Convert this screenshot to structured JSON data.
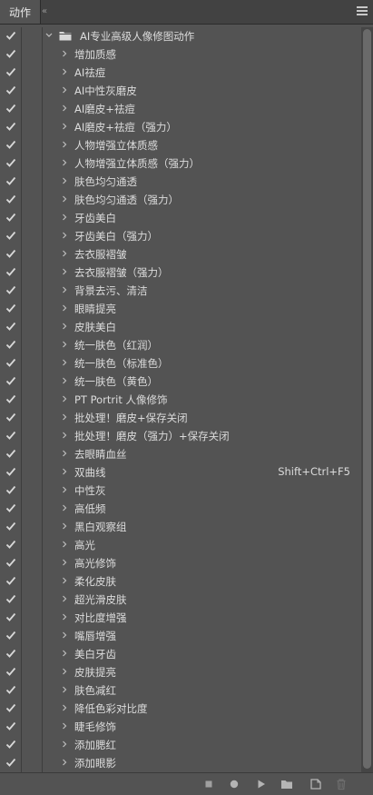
{
  "panel": {
    "tab_label": "动作",
    "tab_close": "«"
  },
  "set": {
    "name": "AI专业高级人像修图动作"
  },
  "actions": [
    {
      "label": "增加质感",
      "dialog": false
    },
    {
      "label": "AI祛痘",
      "dialog": false
    },
    {
      "label": "AI中性灰磨皮",
      "dialog": false
    },
    {
      "label": "AI磨皮+祛痘",
      "dialog": false
    },
    {
      "label": "AI磨皮+祛痘（强力）",
      "dialog": false
    },
    {
      "label": "人物增强立体质感",
      "dialog": false
    },
    {
      "label": "人物增强立体质感（强力）",
      "dialog": false
    },
    {
      "label": "肤色均匀通透",
      "dialog": false
    },
    {
      "label": "肤色均匀通透（强力）",
      "dialog": false
    },
    {
      "label": "牙齿美白",
      "dialog": false
    },
    {
      "label": "牙齿美白（强力）",
      "dialog": false
    },
    {
      "label": "去衣服褶皱",
      "dialog": false
    },
    {
      "label": "去衣服褶皱（强力）",
      "dialog": false
    },
    {
      "label": "背景去污、清洁",
      "dialog": false
    },
    {
      "label": "眼睛提亮",
      "dialog": false
    },
    {
      "label": "皮肤美白",
      "dialog": false
    },
    {
      "label": "统一肤色（红润）",
      "dialog": false
    },
    {
      "label": "统一肤色（标准色）",
      "dialog": false
    },
    {
      "label": "统一肤色（黄色）",
      "dialog": false
    },
    {
      "label": "PT Portrit 人像修饰",
      "dialog": false
    },
    {
      "label": "批处理！磨皮+保存关闭",
      "dialog": false
    },
    {
      "label": "批处理！磨皮（强力）+保存关闭",
      "dialog": false
    },
    {
      "label": "去眼睛血丝",
      "dialog": false
    },
    {
      "label": "双曲线",
      "dialog": false,
      "shortcut": "Shift+Ctrl+F5"
    },
    {
      "label": "中性灰",
      "dialog": false
    },
    {
      "label": "高低频",
      "dialog": false
    },
    {
      "label": "黑白观察组",
      "dialog": false
    },
    {
      "label": "高光",
      "dialog": true
    },
    {
      "label": "高光修饰",
      "dialog": true
    },
    {
      "label": "柔化皮肤",
      "dialog": true
    },
    {
      "label": "超光滑皮肤",
      "dialog": true
    },
    {
      "label": "对比度增强",
      "dialog": false
    },
    {
      "label": "嘴唇增强",
      "dialog": true
    },
    {
      "label": "美白牙齿",
      "dialog": true
    },
    {
      "label": "皮肤提亮",
      "dialog": true
    },
    {
      "label": "肤色减红",
      "dialog": true
    },
    {
      "label": "降低色彩对比度",
      "dialog": true
    },
    {
      "label": "睫毛修饰",
      "dialog": true
    },
    {
      "label": "添加腮红",
      "dialog": true
    },
    {
      "label": "添加眼影",
      "dialog": true
    }
  ],
  "footer": {
    "buttons": [
      "stop-icon",
      "record-icon",
      "play-icon",
      "folder-icon",
      "new-action-icon",
      "trash-icon"
    ]
  },
  "colors": {
    "panel_bg": "#535353",
    "text": "#dcdcdc",
    "header_bg": "#424242"
  }
}
